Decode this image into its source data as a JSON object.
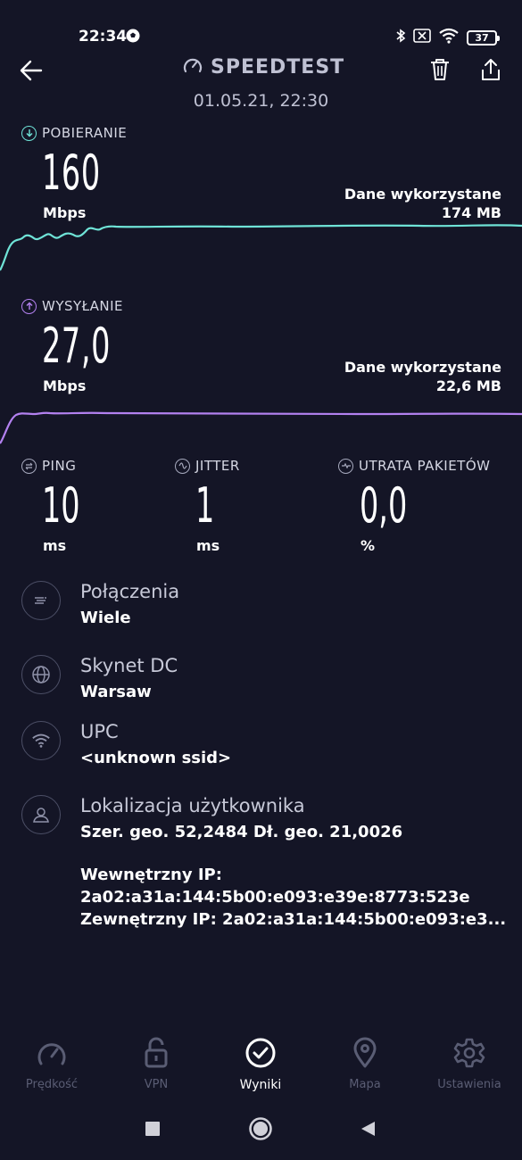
{
  "status_bar": {
    "time": "22:34",
    "battery": "37"
  },
  "header": {
    "title": "SPEEDTEST",
    "date": "01.05.21, 22:30"
  },
  "download": {
    "label": "POBIERANIE",
    "value": "160",
    "unit": "Mbps",
    "data_label": "Dane wykorzystane",
    "data_value": "174 MB",
    "color": "#6fe3d7"
  },
  "upload": {
    "label": "WYSYŁANIE",
    "value": "27,0",
    "unit": "Mbps",
    "data_label": "Dane wykorzystane",
    "data_value": "22,6 MB",
    "color": "#b381f0"
  },
  "metrics": {
    "ping": {
      "label": "PING",
      "value": "10",
      "unit": "ms"
    },
    "jitter": {
      "label": "JITTER",
      "value": "1",
      "unit": "ms"
    },
    "loss": {
      "label": "UTRATA PAKIETÓW",
      "value": "0,0",
      "unit": "%"
    }
  },
  "info": {
    "connections": {
      "title": "Połączenia",
      "value": "Wiele"
    },
    "server": {
      "title": "Skynet DC",
      "value": "Warsaw"
    },
    "provider": {
      "title": "UPC",
      "value": "<unknown ssid>"
    },
    "location": {
      "title": "Lokalizacja użytkownika",
      "value": "Szer. geo. 52,2484 Dł. geo. 21,0026"
    },
    "internal_ip_label": "Wewnętrzny IP:",
    "internal_ip": "2a02:a31a:144:5b00:e093:e39e:8773:523e",
    "external_ip": "Zewnętrzny IP: 2a02:a31a:144:5b00:e093:e3..."
  },
  "nav": {
    "items": [
      {
        "label": "Prędkość",
        "icon": "speedometer-icon"
      },
      {
        "label": "VPN",
        "icon": "unlock-icon"
      },
      {
        "label": "Wyniki",
        "icon": "check-circle-icon",
        "active": true
      },
      {
        "label": "Mapa",
        "icon": "map-pin-icon"
      },
      {
        "label": "Ustawienia",
        "icon": "gear-icon"
      }
    ]
  }
}
